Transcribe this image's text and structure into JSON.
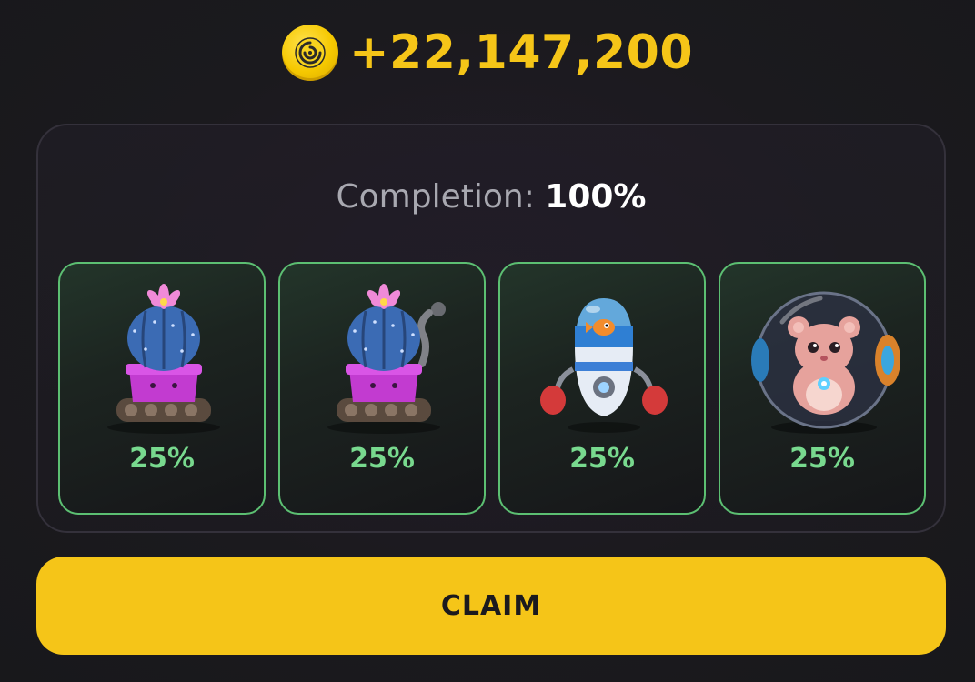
{
  "reward": {
    "icon": "coin-icon",
    "amount": "+22,147,200",
    "color": "#f5c518"
  },
  "panel": {
    "completion_label": "Completion:",
    "completion_value": "100%",
    "cards": [
      {
        "icon": "cactus-tank-icon",
        "percent": "25%"
      },
      {
        "icon": "cactus-tank-smoking-icon",
        "percent": "25%"
      },
      {
        "icon": "boxing-robot-icon",
        "percent": "25%"
      },
      {
        "icon": "hamster-ball-icon",
        "percent": "25%"
      }
    ]
  },
  "claim_button": {
    "label": "CLAIM",
    "color": "#f5c518"
  },
  "colors": {
    "accent_green": "#78d98e",
    "card_border": "#5cbf72",
    "background": "#1b1a1e"
  }
}
